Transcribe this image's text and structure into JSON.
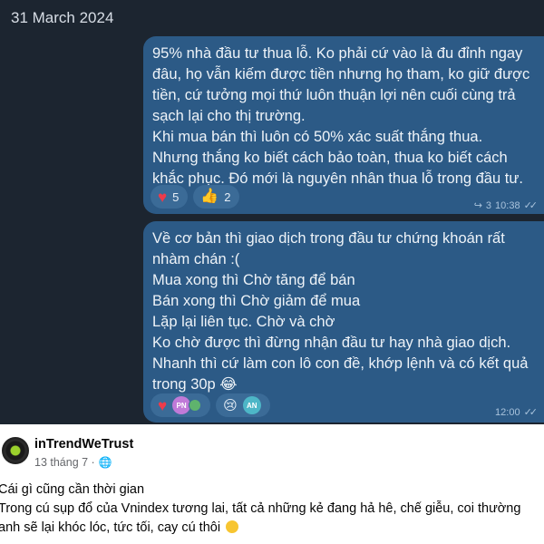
{
  "chat": {
    "date": "31 March 2024",
    "messages": [
      {
        "lines": [
          "95% nhà đầu tư thua lỗ. Ko phải cứ vào là đu đỉnh ngay",
          "đâu, họ vẫn kiếm được tiền nhưng họ tham, ko giữ được",
          "tiền, cứ tưởng mọi thứ luôn thuận lợi nên cuối cùng trả",
          "sạch lại cho thị trường.",
          "Khi mua bán thì luôn có 50% xác suất thắng thua.",
          "Nhưng thắng ko biết cách bảo toàn, thua ko biết cách",
          "khắc phục. Đó mới là nguyên nhân thua lỗ trong đầu tư."
        ],
        "reactions": [
          {
            "icon": "heart-icon",
            "glyph": "♥",
            "count": "5"
          },
          {
            "icon": "thumbs-up-icon",
            "glyph": "👍",
            "count": "2"
          }
        ],
        "forwards": "3",
        "time": "10:38"
      },
      {
        "lines": [
          "Về cơ bản thì giao dịch trong đầu tư chứng khoán rất",
          "nhàm chán :(",
          "Mua xong thì Chờ tăng để bán",
          "Bán xong thì Chờ giảm để mua",
          "Lặp lại liên tục. Chờ và chờ",
          "Ko chờ được thì đừng nhận đầu tư hay nhà giao dịch.",
          "Nhanh thì cứ làm con lô con đề, khớp lệnh và có kết quả",
          "trong 30p 😂"
        ],
        "reactions": [
          {
            "icon": "heart-icon",
            "glyph": "♥",
            "avatars": [
              "PN"
            ]
          },
          {
            "icon": "crying-face-icon",
            "glyph": "😢",
            "avatars": [
              "AN"
            ]
          }
        ],
        "time": "12:00"
      }
    ]
  },
  "post": {
    "author": "inTrendWeTrust",
    "date": "13 tháng 7 ·",
    "privacy_icon": "globe-icon",
    "lines": [
      "Cái gì cũng cần thời gian",
      "Trong cú sụp đổ của Vnindex tương lai, tất cả những kẻ đang hả hê, chế giễu, coi thường",
      "anh sẽ lại khóc lóc, tức tối, cay cú thôi"
    ]
  }
}
